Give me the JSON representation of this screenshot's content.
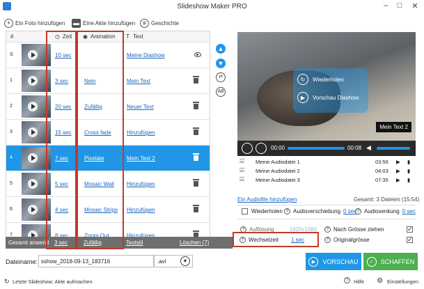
{
  "window": {
    "title": "Slideshow Maker PRO"
  },
  "toolbar": {
    "add_photo": "Ein Foto hinzufügen",
    "add_file": "Eine Akte hinzufügen",
    "history": "Geschichte"
  },
  "table": {
    "headers": {
      "num": "#",
      "zeit": "Zeit",
      "animation": "Animation",
      "text": "Text"
    },
    "rows": [
      {
        "num": "S",
        "zeit": "10 sec",
        "animation": "",
        "text": "Meine Diashow"
      },
      {
        "num": "1",
        "zeit": "3 sec",
        "animation": "Nein",
        "text": "Mein Text"
      },
      {
        "num": "2",
        "zeit": "20 sec",
        "animation": "Zufällig",
        "text": "Neuer Text"
      },
      {
        "num": "3",
        "zeit": "15 sec",
        "animation": "Cross fade",
        "text": "Hinzufügen"
      },
      {
        "num": "4",
        "zeit": "7 sec",
        "animation": "Pixelate",
        "text": "Mein Text 2"
      },
      {
        "num": "5",
        "zeit": "5 sec",
        "animation": "Mosaic Wall",
        "text": "Hinzufügen"
      },
      {
        "num": "6",
        "zeit": "4 sec",
        "animation": "Mosaic Strips",
        "text": "Hinzufügen"
      },
      {
        "num": "7",
        "zeit": "8 sec",
        "animation": "Zoom Out",
        "text": "Hinzufügen"
      }
    ]
  },
  "bottombar": {
    "label": "Gesamt anwend",
    "zeit": "3 sec",
    "animation": "Zufällig",
    "textstil": "Textstil",
    "delete": "Löschen (7)"
  },
  "sidebuttons": {
    "ab": "AB"
  },
  "preview": {
    "overlay_repeat": "Wiederholen",
    "overlay_preview": "Vorschau Diashow",
    "caption": "Mein Text 2"
  },
  "player": {
    "time_start": "00:00",
    "time_end": "00:08"
  },
  "audio": {
    "files": [
      {
        "name": "Meine Audiodatei 1",
        "duration": "03:56"
      },
      {
        "name": "Meine Audiodatei 2",
        "duration": "04:03"
      },
      {
        "name": "Meine Audiodatei 3",
        "duration": "07:35"
      }
    ],
    "add_link": "Ein Audiofile hinzufügen",
    "total": "Gesamt: 3 Dateien (15:54)",
    "repeat": "Wiederholen",
    "shift_label": "Audioverschiebung",
    "shift_value": "0 sec",
    "lower_label": "Audiosenkung",
    "lower_value": "0 sec"
  },
  "settings": {
    "resolution_label": "Auflösung",
    "resolution_value": "1920x1080",
    "fit_label": "Nach Grösse ziehen",
    "transition_label": "Wechselzeit",
    "transition_value": "1 sec",
    "original_label": "Originalgrösse"
  },
  "file": {
    "label": "Dateiname:",
    "value": "sshow_2018-09-13_183716",
    "ext": ".avi"
  },
  "actions": {
    "preview": "VORSCHAU",
    "create": "SCHAFFEN"
  },
  "footer": {
    "last": "Letzte Slideshow: Akte aufmachen",
    "help": "Hilfe",
    "settings": "Einstellungen"
  },
  "colors": {
    "accent": "#2196e6",
    "highlight": "#c0392b",
    "create": "#4caf50"
  }
}
